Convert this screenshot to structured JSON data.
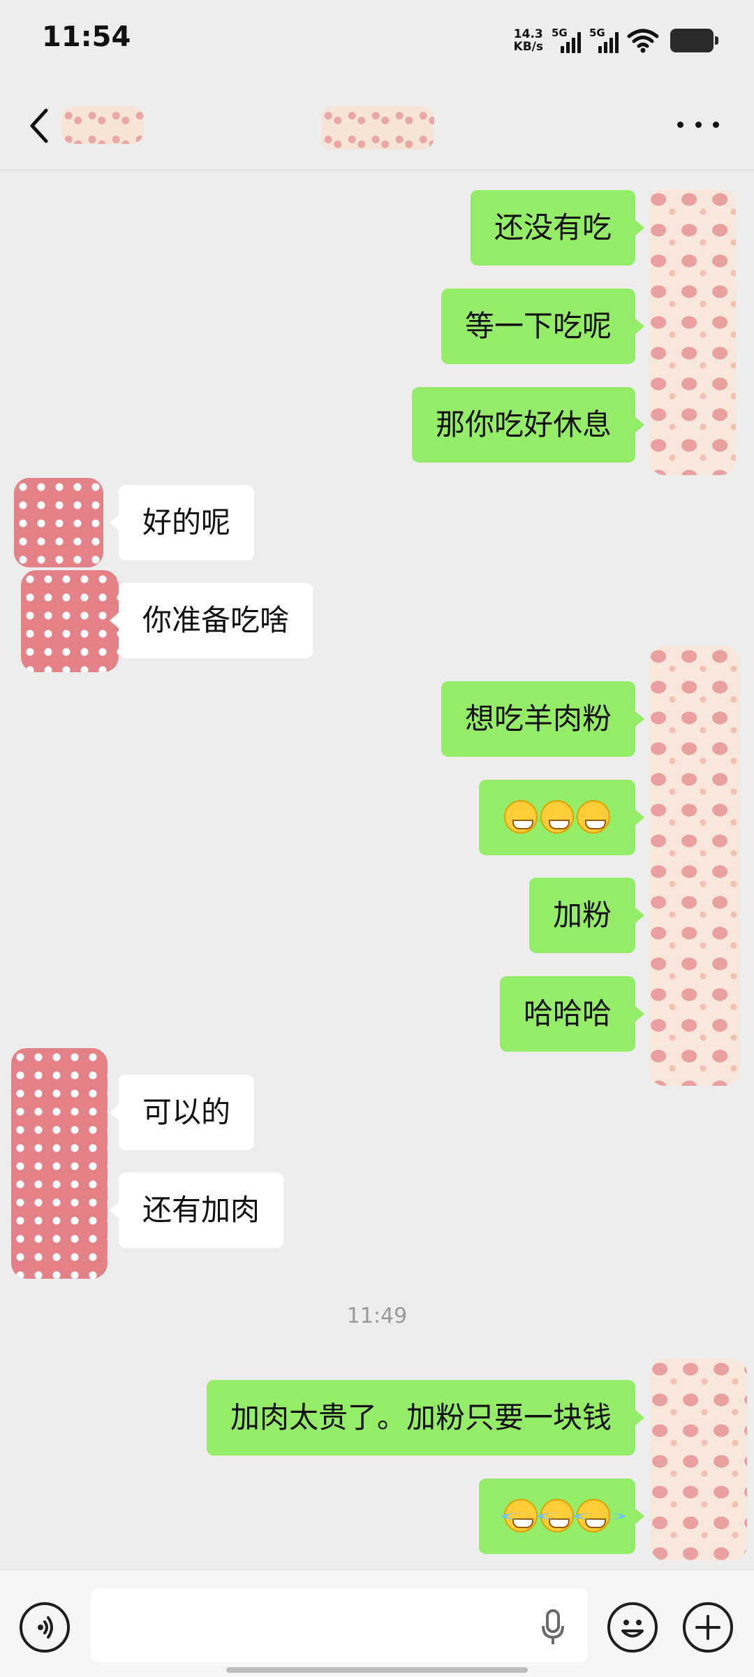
{
  "status_bar": {
    "time": "11:54",
    "net_speed_value": "14.3",
    "net_speed_unit": "KB/s",
    "signal1_label": "5G",
    "signal2_label": "5G"
  },
  "header": {
    "back_icon": "chevron-left-icon",
    "more_icon": "more-horizontal-icon"
  },
  "messages": [
    {
      "side": "me",
      "text": "还没有吃"
    },
    {
      "side": "me",
      "text": "等一下吃呢"
    },
    {
      "side": "me",
      "text": "那你吃好休息"
    },
    {
      "side": "other",
      "text": "好的呢"
    },
    {
      "side": "other",
      "text": "你准备吃啥"
    },
    {
      "side": "me",
      "text": "想吃羊肉粉"
    },
    {
      "side": "me",
      "emoji": "grin",
      "emoji_count": 3
    },
    {
      "side": "me",
      "text": "加粉"
    },
    {
      "side": "me",
      "text": "哈哈哈"
    },
    {
      "side": "other",
      "text": "可以的"
    },
    {
      "side": "other",
      "text": "还有加肉"
    },
    {
      "side": "me",
      "text": "加肉太贵了。加粉只要一块钱"
    },
    {
      "side": "me",
      "emoji": "tears-of-joy",
      "emoji_count": 3
    }
  ],
  "time_divider": "11:49",
  "input_bar": {
    "voice_icon": "voice-icon",
    "mic_icon": "microphone-icon",
    "emoji_icon": "emoji-icon",
    "plus_icon": "plus-icon",
    "input_value": ""
  },
  "colors": {
    "background": "#ededed",
    "my_bubble": "#95ec69",
    "other_bubble": "#ffffff"
  }
}
